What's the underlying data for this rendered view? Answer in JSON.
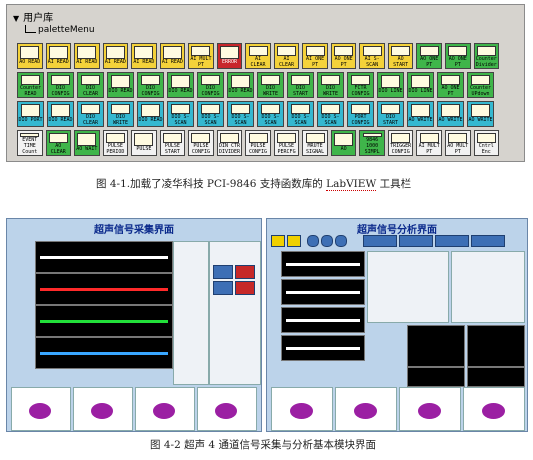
{
  "palette": {
    "header": "用户库",
    "subheader": "paletteMenu",
    "rows": [
      [
        {
          "label": "AO READ",
          "color": "yellow",
          "icon": "ai-read-icon"
        },
        {
          "label": "AI READ",
          "color": "yellow",
          "icon": "ai-read-icon"
        },
        {
          "label": "AI READ",
          "color": "yellow",
          "icon": "ai-read-icon"
        },
        {
          "label": "AI READ",
          "color": "yellow",
          "icon": "ai-read-icon"
        },
        {
          "label": "AI READ",
          "color": "yellow",
          "icon": "ai-read-icon"
        },
        {
          "label": "AI READ",
          "color": "yellow",
          "icon": "ai-read-icon"
        },
        {
          "label": "AI MULT PT",
          "color": "yellow",
          "icon": "ai-mult-pt-icon"
        },
        {
          "label": "ERROR",
          "color": "red",
          "icon": "error-icon"
        },
        {
          "label": "AI CLEAR",
          "color": "yellow",
          "icon": "ai-clear-icon"
        },
        {
          "label": "AI CLEAR",
          "color": "yellow",
          "icon": "ai-clear-icon"
        },
        {
          "label": "AI ONE PT",
          "color": "yellow",
          "icon": "ai-one-pt-icon"
        },
        {
          "label": "AO ONE PT",
          "color": "yellow",
          "icon": "ao-one-pt-icon"
        },
        {
          "label": "AI S-SCAN",
          "color": "yellow",
          "icon": "ai-s-scan-icon"
        },
        {
          "label": "AO START",
          "color": "yellow",
          "icon": "ao-start-icon"
        },
        {
          "label": "AO ONE PT",
          "color": "green",
          "icon": "ao-one-pt-icon"
        },
        {
          "label": "AO ONE PT",
          "color": "green",
          "icon": "ao-one-pt-icon"
        },
        {
          "label": "Counter Divider",
          "color": "green",
          "icon": "counter-divider-icon"
        }
      ],
      [
        {
          "label": "Counter READ",
          "color": "green",
          "icon": "counter-read-icon"
        },
        {
          "label": "DIO CONFIG",
          "color": "green",
          "icon": "dio-config-icon"
        },
        {
          "label": "DIO CLEAR",
          "color": "green",
          "icon": "dio-clear-icon"
        },
        {
          "label": "DIO READ",
          "color": "green",
          "icon": "dio-read-icon"
        },
        {
          "label": "DIO CONFIG",
          "color": "green",
          "icon": "dio-config-icon"
        },
        {
          "label": "DIO READ",
          "color": "green",
          "icon": "dio-read-icon"
        },
        {
          "label": "DIO CONFIG",
          "color": "green",
          "icon": "dio-config-icon"
        },
        {
          "label": "DIO READ",
          "color": "green",
          "icon": "dio-read-icon"
        },
        {
          "label": "DIO WRITE",
          "color": "green",
          "icon": "dio-write-icon"
        },
        {
          "label": "DIO START",
          "color": "green",
          "icon": "dio-start-icon"
        },
        {
          "label": "DIO WRITE",
          "color": "green",
          "icon": "dio-write-icon"
        },
        {
          "label": "FCTR CONFIG",
          "color": "green",
          "icon": "fctr-config-icon"
        },
        {
          "label": "DIO LINE",
          "color": "green",
          "icon": "dio-line-icon"
        },
        {
          "label": "DIO LINE",
          "color": "green",
          "icon": "dio-line-icon"
        },
        {
          "label": "AO ONE PT",
          "color": "green",
          "icon": "ao-one-pt-icon"
        },
        {
          "label": "Counter UPdown",
          "color": "green",
          "icon": "counter-updown-icon"
        }
      ],
      [
        {
          "label": "DIO PORT",
          "color": "cyan",
          "icon": "dio-port-icon"
        },
        {
          "label": "DIO READ",
          "color": "cyan",
          "icon": "dio-read-icon"
        },
        {
          "label": "DIO CLEAR",
          "color": "cyan",
          "icon": "dio-clear-icon"
        },
        {
          "label": "DIO WRITE",
          "color": "cyan",
          "icon": "dio-write-icon"
        },
        {
          "label": "DIO READ",
          "color": "cyan",
          "icon": "dio-read-icon"
        },
        {
          "label": "DIO S-SCAN",
          "color": "cyan",
          "icon": "dio-s-scan-icon"
        },
        {
          "label": "DIO S-SCAN",
          "color": "cyan",
          "icon": "dio-s-scan-icon"
        },
        {
          "label": "DIO S-SCAN",
          "color": "cyan",
          "icon": "dio-s-scan-icon"
        },
        {
          "label": "DIO S-SCAN",
          "color": "cyan",
          "icon": "dio-s-scan-icon"
        },
        {
          "label": "DIO S-SCAN",
          "color": "cyan",
          "icon": "dio-s-scan-icon"
        },
        {
          "label": "DIO S-SCAN",
          "color": "cyan",
          "icon": "dio-s-scan-icon"
        },
        {
          "label": "PORT CONFIG",
          "color": "cyan",
          "icon": "port-config-icon"
        },
        {
          "label": "DIO START",
          "color": "cyan",
          "icon": "dio-start-icon"
        },
        {
          "label": "AO WRITE",
          "color": "cyan",
          "icon": "ao-write-icon"
        },
        {
          "label": "AO WRITE",
          "color": "cyan",
          "icon": "ao-write-icon"
        },
        {
          "label": "AO WRITE",
          "color": "cyan",
          "icon": "ao-write-icon"
        }
      ],
      [
        {
          "label": "EVENT TIME Count",
          "color": "white",
          "icon": "event-time-icon"
        },
        {
          "label": "AO CLEAR",
          "color": "green",
          "icon": "ao-clear-icon"
        },
        {
          "label": "AO WAIT",
          "color": "green",
          "icon": "ao-wait-icon"
        },
        {
          "label": "PULSE PERIOD",
          "color": "white",
          "icon": "pulse-period-icon"
        },
        {
          "label": "PULSE",
          "color": "white",
          "icon": "pulse-icon"
        },
        {
          "label": "PULSE START",
          "color": "white",
          "icon": "pulse-start-icon"
        },
        {
          "label": "PULSE CONFIG",
          "color": "white",
          "icon": "pulse-config-icon"
        },
        {
          "label": "DIN CTR DIVIDER",
          "color": "white",
          "icon": "din-ctr-divider-icon"
        },
        {
          "label": "PULSE CONFIG",
          "color": "white",
          "icon": "pulse-config-icon"
        },
        {
          "label": "PULSE PERCFG",
          "color": "white",
          "icon": "pulse-percfg-icon"
        },
        {
          "label": "MRUTE SIGNAL",
          "color": "white",
          "icon": "mrute-signal-icon"
        },
        {
          "label": "AO",
          "color": "green",
          "icon": "ao-icon"
        },
        {
          "label": "9846 1000 SIMPL",
          "color": "green",
          "icon": "9846-simpl-icon"
        },
        {
          "label": "TRIGGER CONFIG",
          "color": "white",
          "icon": "trigger-config-icon"
        },
        {
          "label": "AI MULT PT",
          "color": "white",
          "icon": "ai-mult-pt-icon"
        },
        {
          "label": "AO MULT PT",
          "color": "white",
          "icon": "ao-mult-pt-icon"
        },
        {
          "label": "Cntrl Enc",
          "color": "white",
          "icon": "cntrl-enc-icon"
        }
      ]
    ]
  },
  "caption1": {
    "prefix": "图 4-1.加载了凌华科技 PCI-9846 支持函数库的 ",
    "emphasis": "LabVIEW",
    "suffix": " 工具栏"
  },
  "panel_acq": {
    "title": "超声信号采集界面"
  },
  "panel_ana": {
    "title": "超声信号分析界面"
  },
  "caption2": "图 4-2  超声 4 通道信号采集与分析基本模块界面",
  "colors": {
    "trace1": "#ffffff",
    "trace2": "#ff2a2a",
    "trace3": "#22e03a",
    "trace4": "#3aa7ff",
    "scatter": "#9b1fa3"
  }
}
